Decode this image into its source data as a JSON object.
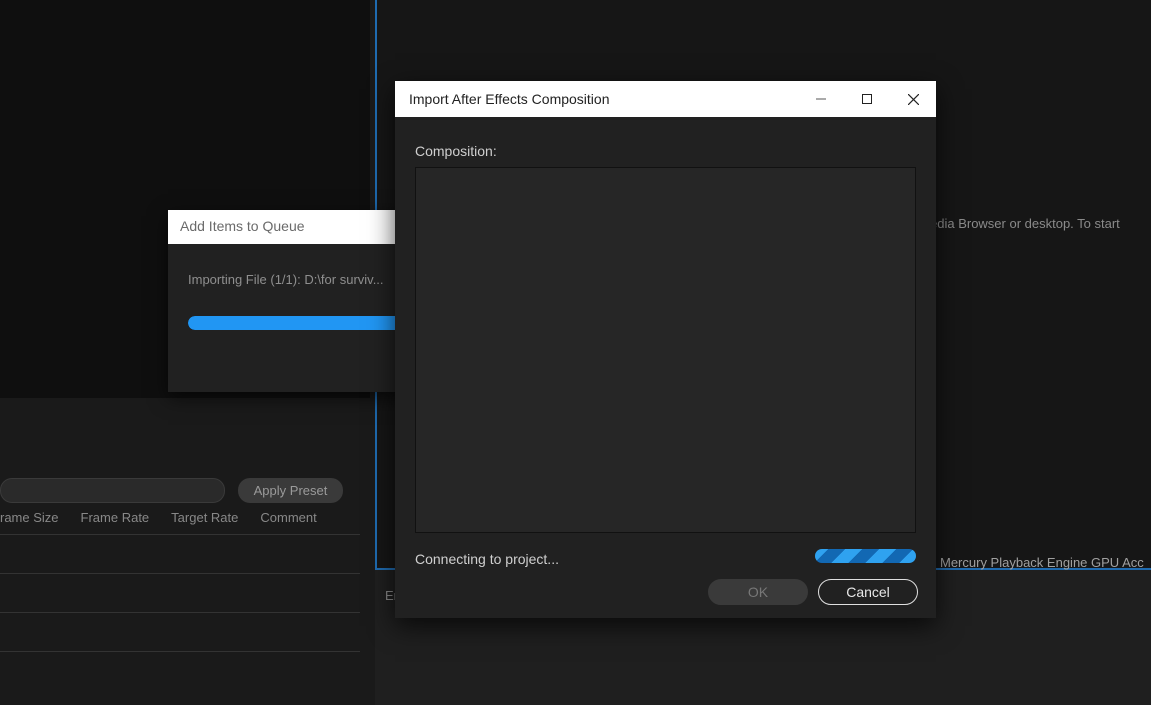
{
  "background": {
    "hint_text": "edia Browser or desktop.  To start ",
    "status_left": "En",
    "status_right": "Mercury Playback Engine GPU Acc"
  },
  "preset": {
    "apply_label": "Apply Preset",
    "columns": {
      "frame_size": "rame Size",
      "frame_rate": "Frame Rate",
      "target_rate": "Target Rate",
      "comment": "Comment"
    }
  },
  "queue_dialog": {
    "title": "Add Items to Queue",
    "status": "Importing File (1/1):  D:\\for surviv..."
  },
  "ae_dialog": {
    "title": "Import After Effects Composition",
    "label": "Composition:",
    "status": "Connecting to project...",
    "ok_label": "OK",
    "cancel_label": "Cancel"
  }
}
